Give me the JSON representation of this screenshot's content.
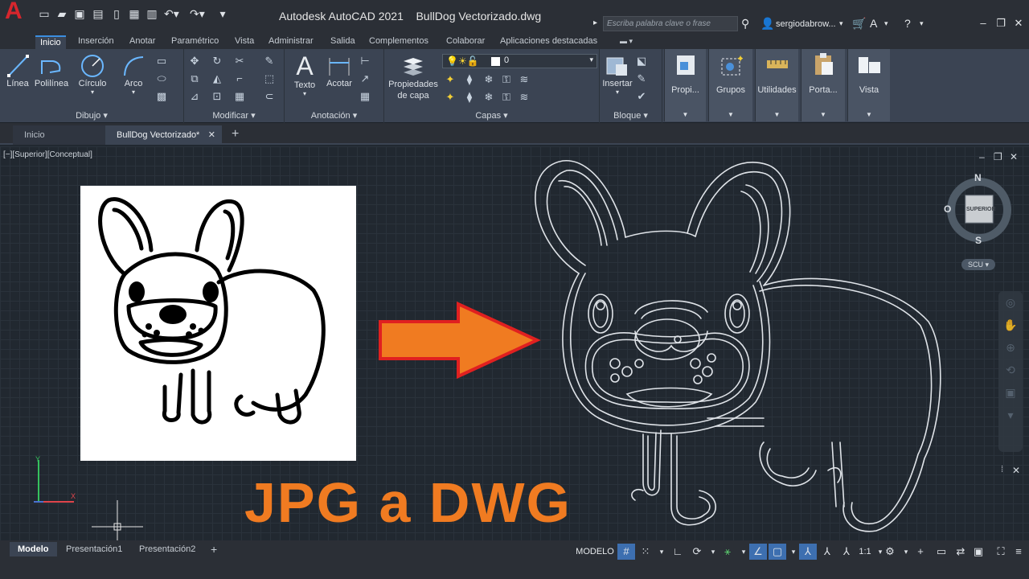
{
  "titlebar": {
    "app_title": "Autodesk AutoCAD 2021",
    "file_title": "BullDog Vectorizado.dwg",
    "search_placeholder": "Escriba palabra clave o frase",
    "user": "sergiodabrow..."
  },
  "ribbon": {
    "tabs": [
      "Inicio",
      "Inserción",
      "Anotar",
      "Paramétrico",
      "Vista",
      "Administrar",
      "Salida",
      "Complementos",
      "Colaborar",
      "Aplicaciones destacadas"
    ],
    "active_tab": "Inicio",
    "panels": {
      "dibujo": {
        "title": "Dibujo",
        "tools": [
          "Línea",
          "Polilínea",
          "Círculo",
          "Arco"
        ]
      },
      "modificar": {
        "title": "Modificar"
      },
      "anotacion": {
        "title": "Anotación",
        "tools": [
          "Texto",
          "Acotar"
        ]
      },
      "capas": {
        "title": "Capas",
        "tools": [
          "Propiedades de capa"
        ],
        "layer_value": "0"
      },
      "bloque": {
        "title": "Bloque",
        "tools": [
          "Insertar"
        ]
      }
    },
    "side_panels": [
      "Propi...",
      "Grupos",
      "Utilidades",
      "Porta...",
      "Vista"
    ]
  },
  "file_tabs": [
    {
      "label": "Inicio",
      "active": false
    },
    {
      "label": "BullDog Vectorizado*",
      "active": true
    }
  ],
  "canvas": {
    "view_label": "[−][Superior][Conceptual]",
    "caption": "JPG a DWG",
    "viewcube": {
      "n": "N",
      "s": "S",
      "w": "O",
      "face": "SUPERIOR",
      "wcs": "SCU"
    }
  },
  "layout_tabs": [
    "Modelo",
    "Presentación1",
    "Presentación2"
  ],
  "status": {
    "model": "MODELO",
    "scale": "1:1"
  },
  "colors": {
    "accent": "#3b8ee0",
    "caption": "#f07b21",
    "arrow_fill": "#f07b21",
    "arrow_stroke": "#e02020",
    "logo": "#d6262d"
  }
}
